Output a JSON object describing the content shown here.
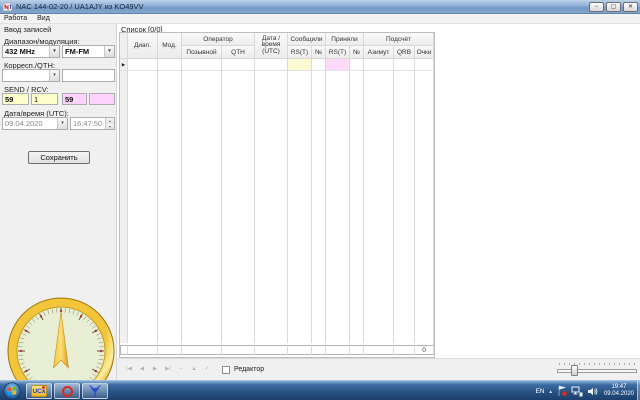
{
  "window": {
    "title": "NAC 144-02-20 / UA1AJY из KO49VV",
    "minimize": "−",
    "maximize": "▢",
    "close": "✕"
  },
  "menu": {
    "items": [
      "Работа",
      "Вид"
    ]
  },
  "entry": {
    "header": "Ввод записей",
    "band_label": "Диапазон/модуляция:",
    "band": "432 MHz",
    "mode": "FM-FM",
    "corr_label": "Корресп./QTH:",
    "corr": "",
    "qth": "",
    "sendrcv_label": "SEND / RCV:",
    "send_rst": "59",
    "send_nr": "1",
    "rcv_rst": "59",
    "rcv_nr": "",
    "datetime_label": "Дата/время (UTC):",
    "date": "09.04.2020",
    "time": "16:47:50",
    "save": "Сохранить"
  },
  "grid": {
    "caption": "Список [0/0]",
    "headers": {
      "diap": "Диап.",
      "mod": "Мод.",
      "operator": "Оператор",
      "callsign": "Позывной",
      "qth": "QTH",
      "datetime": "Дата /\nвремя\n(UTC)",
      "sent": "Сообщили",
      "sent_rst": "RS(T)",
      "sent_nr": "№",
      "rcvd": "Приняли",
      "rcvd_rst": "RS(T)",
      "rcvd_nr": "№",
      "calc": "Подсчёт",
      "azimuth": "Азимут",
      "qrb": "QRB",
      "points": "Очки"
    },
    "summary_points": "0"
  },
  "footer": {
    "nav_icons": [
      "|◀",
      "◀",
      "▶",
      "▶|",
      "−",
      "▲",
      "✓"
    ],
    "editor_label": "Редактор"
  },
  "icons": {
    "dropdown_arrow": "▾",
    "spin_up": "▴",
    "spin_down": "▾",
    "row_marker": "▶",
    "tray_expand": "▲"
  },
  "taskbar": {
    "ucx_label": "UCx",
    "tray_lang": "EN",
    "clock_time": "19:47",
    "clock_date": "09.04.2020"
  },
  "colors": {
    "send_field_bg": "#ffffcc",
    "rcv_field_bg": "#fdd3fd",
    "grid_sent_cell": "#fbfad2",
    "grid_rcvd_cell": "#fdd9fa",
    "titlebar_blue": "#8fb0d6",
    "taskbar_blue": "#275182",
    "compass_gold": "#d9a614"
  }
}
